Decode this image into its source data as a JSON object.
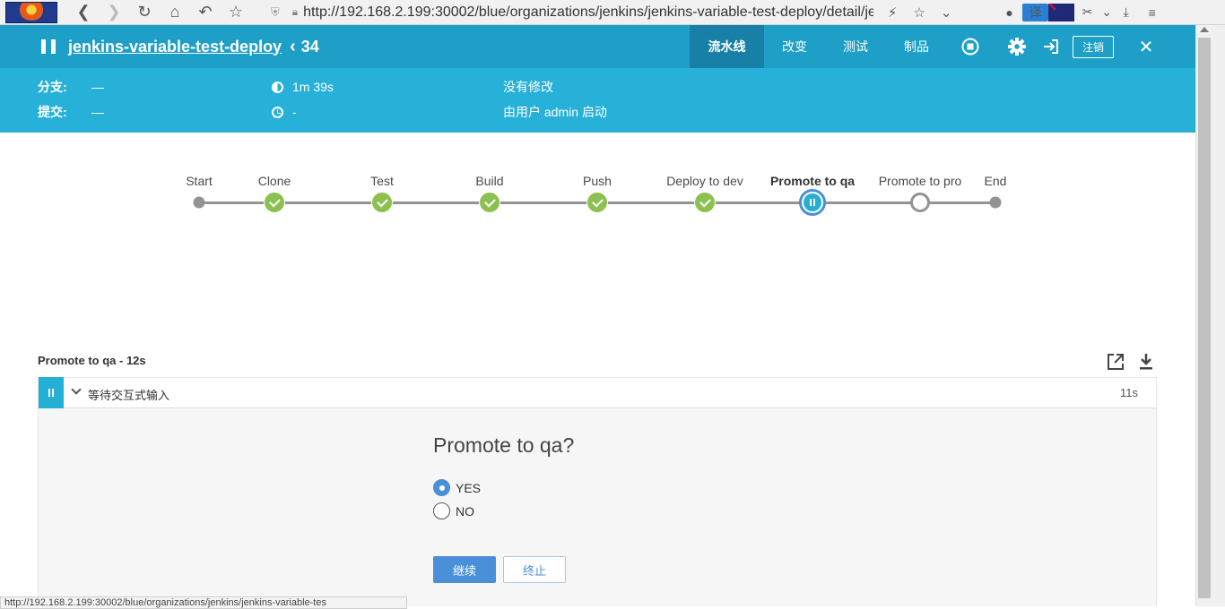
{
  "browser": {
    "url": "http://192.168.2.199:30002/blue/organizations/jenkins/jenkins-variable-test-deploy/detail/jen",
    "status_url": "http://192.168.2.199:30002/blue/organizations/jenkins/jenkins-variable-tes",
    "translate_label": "译"
  },
  "header": {
    "pipeline_name": "jenkins-variable-test-deploy",
    "back_chevron": "‹",
    "run_number": "34",
    "tabs": [
      {
        "label": "流水线",
        "active": true
      },
      {
        "label": "改变",
        "active": false
      },
      {
        "label": "测试",
        "active": false
      },
      {
        "label": "制品",
        "active": false
      }
    ],
    "logout_label": "注销",
    "close_symbol": "✕"
  },
  "info": {
    "branch_label": "分支:",
    "branch_value": "—",
    "commit_label": "提交:",
    "commit_value": "—",
    "duration": "1m 39s",
    "started_ago": "-",
    "changes": "没有修改",
    "started_by": "由用户 admin 启动"
  },
  "stages": [
    {
      "name": "Start",
      "state": "dot"
    },
    {
      "name": "Clone",
      "state": "ok"
    },
    {
      "name": "Test",
      "state": "ok"
    },
    {
      "name": "Build",
      "state": "ok"
    },
    {
      "name": "Push",
      "state": "ok"
    },
    {
      "name": "Deploy to dev",
      "state": "ok"
    },
    {
      "name": "Promote to qa",
      "state": "paused"
    },
    {
      "name": "Promote to pro",
      "state": "pending"
    },
    {
      "name": "End",
      "state": "dot"
    }
  ],
  "step_panel": {
    "title": "Promote to qa - 12s",
    "step_text": "等待交互式输入",
    "step_time": "11s",
    "question": "Promote to qa?",
    "options": [
      {
        "label": "YES",
        "checked": true
      },
      {
        "label": "NO",
        "checked": false
      }
    ],
    "proceed_label": "继续",
    "abort_label": "终止"
  }
}
